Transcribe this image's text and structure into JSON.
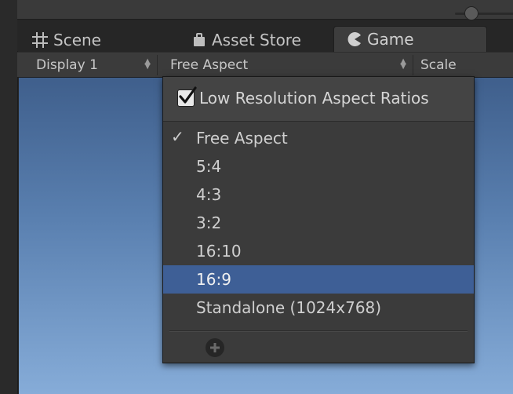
{
  "tabs": {
    "scene": "Scene",
    "asset_store": "Asset Store",
    "game": "Game"
  },
  "toolbar": {
    "display": "Display 1",
    "aspect": "Free Aspect",
    "scale_label": "Scale"
  },
  "menu": {
    "low_res_label": "Low Resolution Aspect Ratios",
    "low_res_checked": true,
    "items": [
      {
        "label": "Free Aspect",
        "checked": true
      },
      {
        "label": "5:4"
      },
      {
        "label": "4:3"
      },
      {
        "label": "3:2"
      },
      {
        "label": "16:10"
      },
      {
        "label": "16:9",
        "highlighted": true
      },
      {
        "label": "Standalone (1024x768)"
      }
    ],
    "checkmark": "✓"
  },
  "colors": {
    "highlight": "#3e5f96",
    "sky_top": "#3f5f8c",
    "sky_bottom": "#86acd8"
  },
  "icons": [
    "grid-icon",
    "asset-store-icon",
    "game-pacman-icon",
    "updown-arrows-icon",
    "checkmark-icon",
    "add-icon"
  ]
}
